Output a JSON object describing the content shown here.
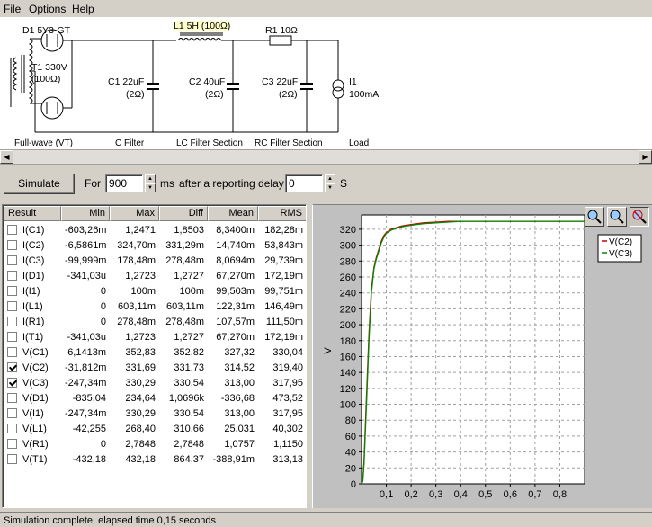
{
  "menu": {
    "file": "File",
    "options": "Options",
    "help": "Help"
  },
  "schematic": {
    "d1": "D1 5Y3-GT",
    "t1a": "T1 330V",
    "t1b": "(100Ω)",
    "l1": "L1 5H (100Ω)",
    "r1": "R1 10Ω",
    "c1a": "C1 22uF",
    "c1b": "(2Ω)",
    "c2a": "C2 40uF",
    "c2b": "(2Ω)",
    "c3a": "C3 22uF",
    "c3b": "(2Ω)",
    "i1a": "I1",
    "i1b": "100mA",
    "sections": {
      "fullwave": "Full-wave (VT)",
      "cfilter": "C Filter",
      "lcfilter": "LC Filter Section",
      "rcfilter": "RC Filter Section",
      "load": "Load"
    }
  },
  "controls": {
    "simulate": "Simulate",
    "for_label": "For",
    "duration": "900",
    "ms_label": "ms",
    "delay_label": "after a reporting delay of",
    "delay": "0",
    "s_label": "S"
  },
  "results": {
    "headers": [
      "Result",
      "Min",
      "Max",
      "Diff",
      "Mean",
      "RMS"
    ],
    "rows": [
      {
        "name": "I(C1)",
        "checked": false,
        "min": "-603,26m",
        "max": "1,2471",
        "diff": "1,8503",
        "mean": "8,3400m",
        "rms": "182,28m"
      },
      {
        "name": "I(C2)",
        "checked": false,
        "min": "-6,5861m",
        "max": "324,70m",
        "diff": "331,29m",
        "mean": "14,740m",
        "rms": "53,843m"
      },
      {
        "name": "I(C3)",
        "checked": false,
        "min": "-99,999m",
        "max": "178,48m",
        "diff": "278,48m",
        "mean": "8,0694m",
        "rms": "29,739m"
      },
      {
        "name": "I(D1)",
        "checked": false,
        "min": "-341,03u",
        "max": "1,2723",
        "diff": "1,2727",
        "mean": "67,270m",
        "rms": "172,19m"
      },
      {
        "name": "I(I1)",
        "checked": false,
        "min": "0",
        "max": "100m",
        "diff": "100m",
        "mean": "99,503m",
        "rms": "99,751m"
      },
      {
        "name": "I(L1)",
        "checked": false,
        "min": "0",
        "max": "603,11m",
        "diff": "603,11m",
        "mean": "122,31m",
        "rms": "146,49m"
      },
      {
        "name": "I(R1)",
        "checked": false,
        "min": "0",
        "max": "278,48m",
        "diff": "278,48m",
        "mean": "107,57m",
        "rms": "111,50m"
      },
      {
        "name": "I(T1)",
        "checked": false,
        "min": "-341,03u",
        "max": "1,2723",
        "diff": "1,2727",
        "mean": "67,270m",
        "rms": "172,19m"
      },
      {
        "name": "V(C1)",
        "checked": false,
        "min": "6,1413m",
        "max": "352,83",
        "diff": "352,82",
        "mean": "327,32",
        "rms": "330,04"
      },
      {
        "name": "V(C2)",
        "checked": true,
        "min": "-31,812m",
        "max": "331,69",
        "diff": "331,73",
        "mean": "314,52",
        "rms": "319,40"
      },
      {
        "name": "V(C3)",
        "checked": true,
        "min": "-247,34m",
        "max": "330,29",
        "diff": "330,54",
        "mean": "313,00",
        "rms": "317,95"
      },
      {
        "name": "V(D1)",
        "checked": false,
        "min": "-835,04",
        "max": "234,64",
        "diff": "1,0696k",
        "mean": "-336,68",
        "rms": "473,52"
      },
      {
        "name": "V(I1)",
        "checked": false,
        "min": "-247,34m",
        "max": "330,29",
        "diff": "330,54",
        "mean": "313,00",
        "rms": "317,95"
      },
      {
        "name": "V(L1)",
        "checked": false,
        "min": "-42,255",
        "max": "268,40",
        "diff": "310,66",
        "mean": "25,031",
        "rms": "40,302"
      },
      {
        "name": "V(R1)",
        "checked": false,
        "min": "0",
        "max": "2,7848",
        "diff": "2,7848",
        "mean": "1,0757",
        "rms": "1,1150"
      },
      {
        "name": "V(T1)",
        "checked": false,
        "min": "-432,18",
        "max": "432,18",
        "diff": "864,37",
        "mean": "-388,91m",
        "rms": "313,13"
      }
    ]
  },
  "chart_data": {
    "type": "line",
    "ylabel": "V",
    "xlabel": "",
    "xlim": [
      0,
      0.9
    ],
    "ylim": [
      0,
      330
    ],
    "x_ticks": [
      "0,1",
      "0,2",
      "0,3",
      "0,4",
      "0,5",
      "0,6",
      "0,7",
      "0,8"
    ],
    "y_ticks": [
      "0",
      "20",
      "40",
      "60",
      "80",
      "100",
      "120",
      "140",
      "160",
      "180",
      "200",
      "220",
      "240",
      "260",
      "280",
      "300",
      "320"
    ],
    "grid": true,
    "legend_position": "top-right",
    "series": [
      {
        "name": "V(C2)",
        "color": "#cc0000",
        "x": [
          0,
          0.005,
          0.01,
          0.02,
          0.03,
          0.04,
          0.05,
          0.06,
          0.07,
          0.08,
          0.09,
          0.1,
          0.12,
          0.14,
          0.16,
          0.18,
          0.2,
          0.25,
          0.3,
          0.35,
          0.4,
          0.5,
          0.6,
          0.7,
          0.8,
          0.9
        ],
        "values": [
          0,
          5,
          30,
          110,
          190,
          245,
          272,
          285,
          295,
          305,
          312,
          316,
          320,
          322,
          324,
          325,
          326,
          328,
          329,
          330,
          330,
          330,
          330,
          330,
          330,
          330
        ]
      },
      {
        "name": "V(C3)",
        "color": "#008800",
        "x": [
          0,
          0.005,
          0.01,
          0.02,
          0.03,
          0.04,
          0.05,
          0.06,
          0.07,
          0.08,
          0.09,
          0.1,
          0.12,
          0.14,
          0.16,
          0.18,
          0.2,
          0.25,
          0.3,
          0.35,
          0.4,
          0.5,
          0.6,
          0.7,
          0.8,
          0.9
        ],
        "values": [
          0,
          3,
          25,
          100,
          182,
          240,
          270,
          283,
          293,
          303,
          310,
          315,
          319,
          321,
          323,
          324,
          325,
          327,
          328,
          329,
          330,
          330,
          330,
          330,
          330,
          330
        ]
      }
    ]
  },
  "status": "Simulation complete, elapsed time 0,15 seconds"
}
